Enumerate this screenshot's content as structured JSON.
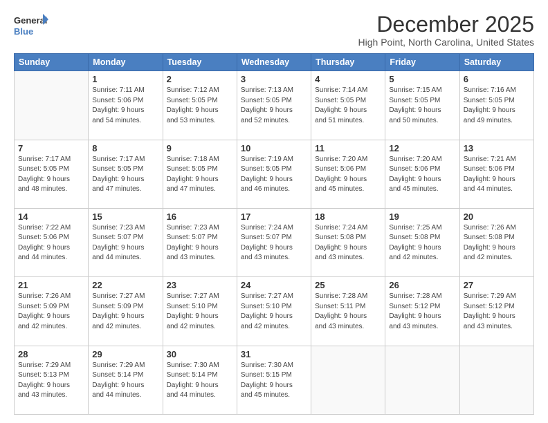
{
  "logo": {
    "line1": "General",
    "line2": "Blue"
  },
  "title": "December 2025",
  "location": "High Point, North Carolina, United States",
  "headers": [
    "Sunday",
    "Monday",
    "Tuesday",
    "Wednesday",
    "Thursday",
    "Friday",
    "Saturday"
  ],
  "weeks": [
    [
      {
        "day": "",
        "info": ""
      },
      {
        "day": "1",
        "info": "Sunrise: 7:11 AM\nSunset: 5:06 PM\nDaylight: 9 hours\nand 54 minutes."
      },
      {
        "day": "2",
        "info": "Sunrise: 7:12 AM\nSunset: 5:05 PM\nDaylight: 9 hours\nand 53 minutes."
      },
      {
        "day": "3",
        "info": "Sunrise: 7:13 AM\nSunset: 5:05 PM\nDaylight: 9 hours\nand 52 minutes."
      },
      {
        "day": "4",
        "info": "Sunrise: 7:14 AM\nSunset: 5:05 PM\nDaylight: 9 hours\nand 51 minutes."
      },
      {
        "day": "5",
        "info": "Sunrise: 7:15 AM\nSunset: 5:05 PM\nDaylight: 9 hours\nand 50 minutes."
      },
      {
        "day": "6",
        "info": "Sunrise: 7:16 AM\nSunset: 5:05 PM\nDaylight: 9 hours\nand 49 minutes."
      }
    ],
    [
      {
        "day": "7",
        "info": "Sunrise: 7:17 AM\nSunset: 5:05 PM\nDaylight: 9 hours\nand 48 minutes."
      },
      {
        "day": "8",
        "info": "Sunrise: 7:17 AM\nSunset: 5:05 PM\nDaylight: 9 hours\nand 47 minutes."
      },
      {
        "day": "9",
        "info": "Sunrise: 7:18 AM\nSunset: 5:05 PM\nDaylight: 9 hours\nand 47 minutes."
      },
      {
        "day": "10",
        "info": "Sunrise: 7:19 AM\nSunset: 5:05 PM\nDaylight: 9 hours\nand 46 minutes."
      },
      {
        "day": "11",
        "info": "Sunrise: 7:20 AM\nSunset: 5:06 PM\nDaylight: 9 hours\nand 45 minutes."
      },
      {
        "day": "12",
        "info": "Sunrise: 7:20 AM\nSunset: 5:06 PM\nDaylight: 9 hours\nand 45 minutes."
      },
      {
        "day": "13",
        "info": "Sunrise: 7:21 AM\nSunset: 5:06 PM\nDaylight: 9 hours\nand 44 minutes."
      }
    ],
    [
      {
        "day": "14",
        "info": "Sunrise: 7:22 AM\nSunset: 5:06 PM\nDaylight: 9 hours\nand 44 minutes."
      },
      {
        "day": "15",
        "info": "Sunrise: 7:23 AM\nSunset: 5:07 PM\nDaylight: 9 hours\nand 44 minutes."
      },
      {
        "day": "16",
        "info": "Sunrise: 7:23 AM\nSunset: 5:07 PM\nDaylight: 9 hours\nand 43 minutes."
      },
      {
        "day": "17",
        "info": "Sunrise: 7:24 AM\nSunset: 5:07 PM\nDaylight: 9 hours\nand 43 minutes."
      },
      {
        "day": "18",
        "info": "Sunrise: 7:24 AM\nSunset: 5:08 PM\nDaylight: 9 hours\nand 43 minutes."
      },
      {
        "day": "19",
        "info": "Sunrise: 7:25 AM\nSunset: 5:08 PM\nDaylight: 9 hours\nand 42 minutes."
      },
      {
        "day": "20",
        "info": "Sunrise: 7:26 AM\nSunset: 5:08 PM\nDaylight: 9 hours\nand 42 minutes."
      }
    ],
    [
      {
        "day": "21",
        "info": "Sunrise: 7:26 AM\nSunset: 5:09 PM\nDaylight: 9 hours\nand 42 minutes."
      },
      {
        "day": "22",
        "info": "Sunrise: 7:27 AM\nSunset: 5:09 PM\nDaylight: 9 hours\nand 42 minutes."
      },
      {
        "day": "23",
        "info": "Sunrise: 7:27 AM\nSunset: 5:10 PM\nDaylight: 9 hours\nand 42 minutes."
      },
      {
        "day": "24",
        "info": "Sunrise: 7:27 AM\nSunset: 5:10 PM\nDaylight: 9 hours\nand 42 minutes."
      },
      {
        "day": "25",
        "info": "Sunrise: 7:28 AM\nSunset: 5:11 PM\nDaylight: 9 hours\nand 43 minutes."
      },
      {
        "day": "26",
        "info": "Sunrise: 7:28 AM\nSunset: 5:12 PM\nDaylight: 9 hours\nand 43 minutes."
      },
      {
        "day": "27",
        "info": "Sunrise: 7:29 AM\nSunset: 5:12 PM\nDaylight: 9 hours\nand 43 minutes."
      }
    ],
    [
      {
        "day": "28",
        "info": "Sunrise: 7:29 AM\nSunset: 5:13 PM\nDaylight: 9 hours\nand 43 minutes."
      },
      {
        "day": "29",
        "info": "Sunrise: 7:29 AM\nSunset: 5:14 PM\nDaylight: 9 hours\nand 44 minutes."
      },
      {
        "day": "30",
        "info": "Sunrise: 7:30 AM\nSunset: 5:14 PM\nDaylight: 9 hours\nand 44 minutes."
      },
      {
        "day": "31",
        "info": "Sunrise: 7:30 AM\nSunset: 5:15 PM\nDaylight: 9 hours\nand 45 minutes."
      },
      {
        "day": "",
        "info": ""
      },
      {
        "day": "",
        "info": ""
      },
      {
        "day": "",
        "info": ""
      }
    ]
  ]
}
